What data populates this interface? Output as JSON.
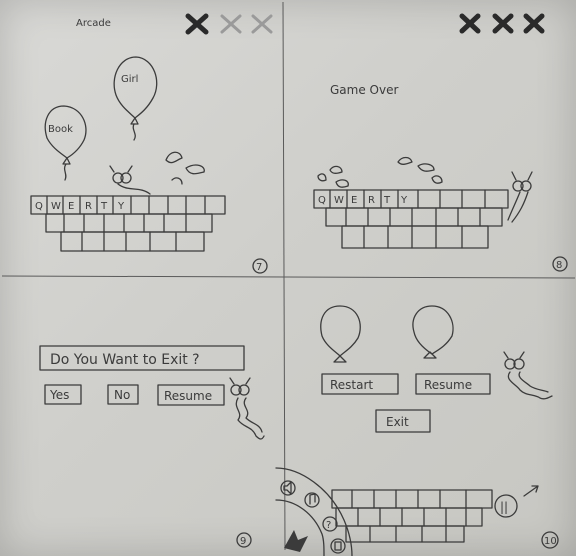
{
  "panel_7": {
    "title": "Arcade",
    "balloons": [
      "Girl",
      "Book"
    ],
    "keys": [
      "Q",
      "W",
      "E",
      "R",
      "T",
      "Y"
    ],
    "page_number": "7"
  },
  "panel_8": {
    "title": "Game Over",
    "keys": [
      "Q",
      "W",
      "E",
      "R",
      "T",
      "Y"
    ],
    "page_number": "8"
  },
  "panel_9": {
    "dialog_text": "Do You Want to Exit ?",
    "yes_label": "Yes",
    "no_label": "No",
    "resume_label": "Resume",
    "page_number": "9"
  },
  "panel_10": {
    "restart_label": "Restart",
    "resume_label": "Resume",
    "exit_label": "Exit",
    "pause_symbol": "||",
    "page_number": "10"
  }
}
